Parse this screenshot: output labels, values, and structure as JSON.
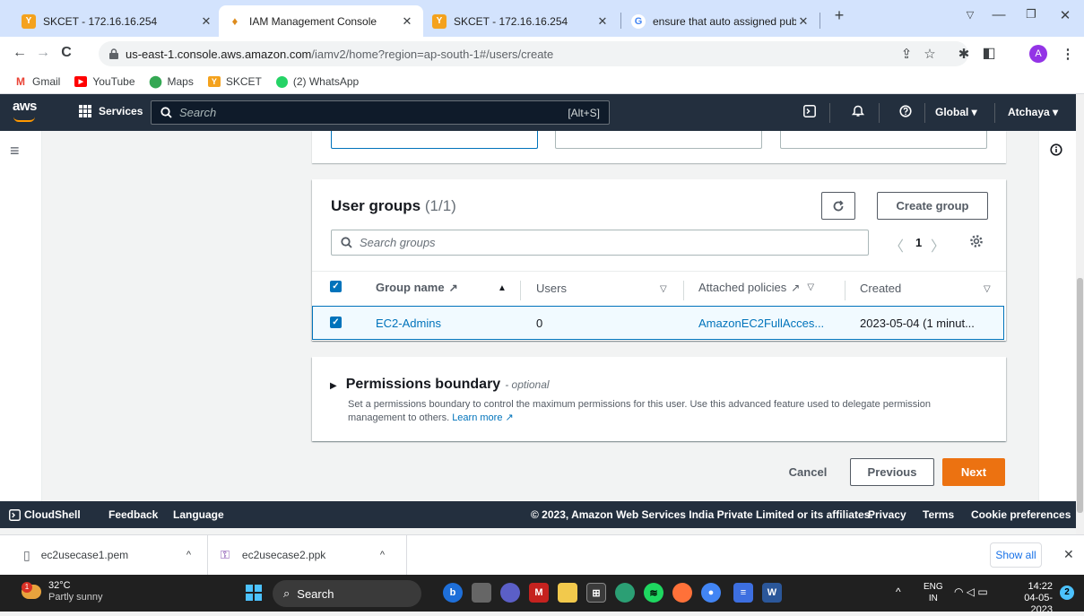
{
  "browser": {
    "tabs": [
      {
        "title": "SKCET - 172.16.16.254",
        "active": false
      },
      {
        "title": "IAM Management Console",
        "active": true
      },
      {
        "title": "SKCET - 172.16.16.254",
        "active": false
      },
      {
        "title": "ensure that auto assigned public",
        "active": false
      }
    ],
    "url_host": "us-east-1.console.aws.amazon.com",
    "url_path": "/iamv2/home?region=ap-south-1#/users/create",
    "profile_initial": "A",
    "bookmarks": [
      "Gmail",
      "YouTube",
      "Maps",
      "SKCET",
      "(2) WhatsApp"
    ]
  },
  "aws_nav": {
    "logo": "aws",
    "services_label": "Services",
    "search_placeholder": "Search",
    "search_hint": "[Alt+S]",
    "region": "Global ▾",
    "user": "Atchaya ▾"
  },
  "user_groups": {
    "title": "User groups",
    "count": "(1/1)",
    "create_label": "Create group",
    "search_placeholder": "Search groups",
    "page": "1",
    "columns": {
      "group_name": "Group name",
      "users": "Users",
      "attached_policies": "Attached policies",
      "created": "Created"
    },
    "rows": [
      {
        "group_name": "EC2-Admins",
        "users": "0",
        "attached_policies": "AmazonEC2FullAcces...",
        "created": "2023-05-04 (1 minut..."
      }
    ]
  },
  "permissions_boundary": {
    "title": "Permissions boundary",
    "optional": "- optional",
    "description": "Set a permissions boundary to control the maximum permissions for this user. Use this advanced feature used to delegate permission management to others.",
    "learn_more": "Learn more"
  },
  "actions": {
    "cancel": "Cancel",
    "previous": "Previous",
    "next": "Next"
  },
  "footer": {
    "cloudshell": "CloudShell",
    "feedback": "Feedback",
    "language": "Language",
    "copyright": "© 2023, Amazon Web Services India Private Limited or its affiliates.",
    "privacy": "Privacy",
    "terms": "Terms",
    "cookies": "Cookie preferences"
  },
  "downloads": {
    "items": [
      "ec2usecase1.pem",
      "ec2usecase2.ppk"
    ],
    "show_all": "Show all"
  },
  "taskbar": {
    "temperature": "32°C",
    "weather": "Partly sunny",
    "weather_badge": "1",
    "search_label": "Search",
    "lang_top": "ENG",
    "lang_bottom": "IN",
    "time": "14:22",
    "date": "04-05-2023",
    "notif_count": "2"
  },
  "colors": {
    "aws_nav": "#232f3e",
    "aws_orange": "#ec7211",
    "link_blue": "#0073bb",
    "chrome_tabstrip": "#d3e3fd"
  }
}
